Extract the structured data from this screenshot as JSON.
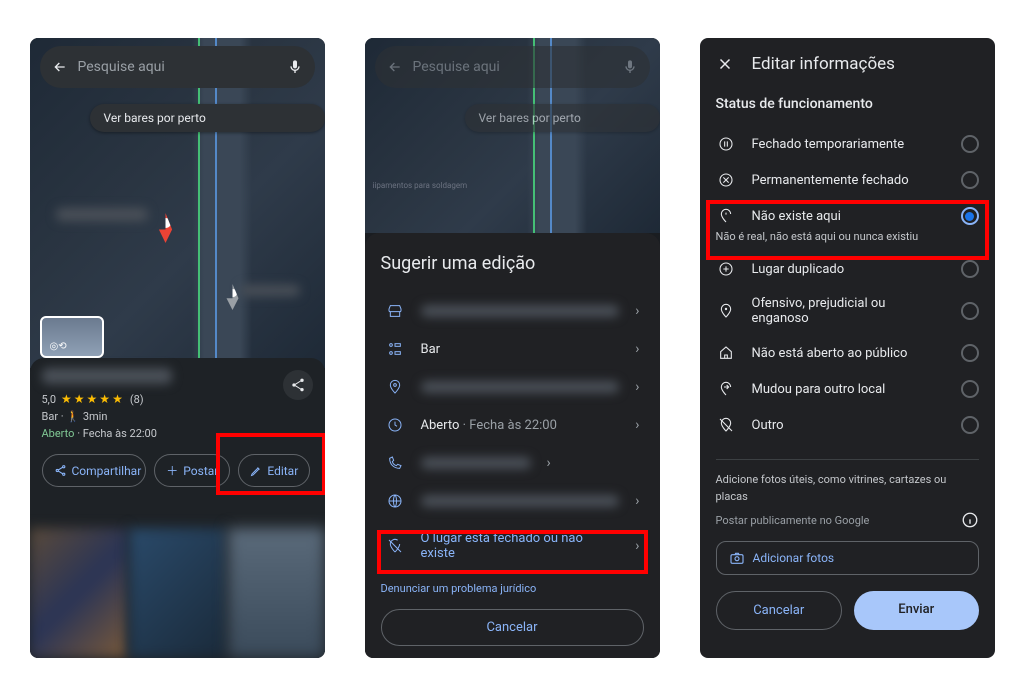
{
  "common": {
    "search_placeholder": "Pesquise aqui",
    "nearby_chip": "Ver bares por perto"
  },
  "screen1": {
    "rating": "5,0",
    "reviews_count": "(8)",
    "category": "Bar",
    "walk_time": "3min",
    "open_label": "Aberto",
    "hours": "Fecha às 22:00",
    "actions": {
      "share": "Compartilhar",
      "post": "Postar",
      "edit": "Editar"
    }
  },
  "screen2": {
    "title": "Sugerir uma edição",
    "tiny_map_label": "iipamentos para soldagem",
    "items": {
      "category": "Bar",
      "hours_open": "Aberto",
      "hours_close": "Fecha às 22:00",
      "closed_or_missing": "O lugar está fechado ou não existe"
    },
    "legal_link": "Denunciar um problema jurídico",
    "cancel": "Cancelar"
  },
  "screen3": {
    "title": "Editar informações",
    "section": "Status de funcionamento",
    "options": [
      {
        "icon": "pause",
        "label": "Fechado temporariamente"
      },
      {
        "icon": "closed",
        "label": "Permanentemente fechado"
      },
      {
        "icon": "not-here",
        "label": "Não existe aqui",
        "sub": "Não é real, não está aqui ou nunca existiu",
        "selected": true
      },
      {
        "icon": "duplicate",
        "label": "Lugar duplicado"
      },
      {
        "icon": "offensive",
        "label": "Ofensivo, prejudicial ou enganoso"
      },
      {
        "icon": "private",
        "label": "Não está aberto ao público"
      },
      {
        "icon": "moved",
        "label": "Mudou para outro local"
      },
      {
        "icon": "other",
        "label": "Outro"
      }
    ],
    "photos_help": "Adicione fotos úteis, como vitrines, cartazes ou placas",
    "public_notice": "Postar publicamente no Google",
    "add_photos": "Adicionar fotos",
    "cancel": "Cancelar",
    "submit": "Enviar"
  }
}
